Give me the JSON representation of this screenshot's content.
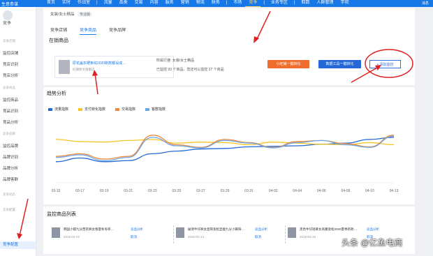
{
  "topbar": {
    "brand": "生意参谋",
    "nav": [
      "首页",
      "实时",
      "作战室",
      "|",
      "流量",
      "品类",
      "交易",
      "内容",
      "服务",
      "营销",
      "物流",
      "财务",
      "|",
      "市场",
      "竞争",
      "|",
      "业务专区",
      "|",
      "取数",
      "人群管理",
      "学院"
    ],
    "active": "竞争",
    "user": "消息"
  },
  "sidebar": {
    "avatar_name": "竞争",
    "items": [
      {
        "type": "group",
        "label": "竞争店铺"
      },
      {
        "type": "item",
        "label": "监控店铺"
      },
      {
        "type": "item",
        "label": "竞店识别"
      },
      {
        "type": "item",
        "label": "竞店分析"
      },
      {
        "type": "group",
        "label": "竞争商品"
      },
      {
        "type": "item",
        "label": "监控商品"
      },
      {
        "type": "item",
        "label": "竞品识别"
      },
      {
        "type": "item",
        "label": "竞品分析"
      },
      {
        "type": "group",
        "label": "竞争品牌"
      },
      {
        "type": "item",
        "label": "监控品牌"
      },
      {
        "type": "item",
        "label": "品牌识别"
      },
      {
        "type": "item",
        "label": "品牌分析"
      },
      {
        "type": "item",
        "label": "品牌客群"
      },
      {
        "type": "group",
        "label": "竞争动态"
      },
      {
        "type": "group",
        "label": "竞争配置"
      },
      {
        "type": "active",
        "label": "竞争配置"
      }
    ]
  },
  "category": {
    "value": "女装/女士精品",
    "switch": "专业版"
  },
  "tabs": [
    "竞争店铺",
    "竞争商品",
    "竞争品牌"
  ],
  "active_tab": "竞争商品",
  "product_section": {
    "title": "在销商品",
    "product_title": "原花盖衣裙条纹2020新款都设成…",
    "shop": "好潮原文旗舰店",
    "category_line": "所属行业: 女装/女士精品",
    "quota_line": "已监控 93 个商品，您还可以监控 27 个商品",
    "btn_orange": "小旺铺一键转化",
    "btn_blue": "数据工具一键转化",
    "btn_add": "+ 添加监控"
  },
  "trend": {
    "title": "趋势分析",
    "colors": {
      "blue": "#2468d8",
      "yellow": "#f3c623",
      "orange": "#f0883a",
      "lightblue": "#6aa7e8"
    }
  },
  "chart_data": {
    "type": "line",
    "title": "趋势分析",
    "xlabel": "",
    "ylabel": "",
    "x": [
      "03-15",
      "03-17",
      "03-19",
      "03-21",
      "03-23",
      "03-25",
      "03-27",
      "03-29",
      "03-31",
      "04-02",
      "04-04",
      "04-06",
      "04-08",
      "04-10",
      "04-13"
    ],
    "legend_position": "top-left",
    "grid": false,
    "series": [
      {
        "name": "流量指数",
        "color": "#2468d8",
        "values": [
          20,
          27,
          20,
          22,
          35,
          40,
          44,
          45,
          48,
          49,
          50,
          53,
          55,
          62,
          66
        ]
      },
      {
        "name": "支付转化指数",
        "color": "#f3c623",
        "values": [
          62,
          58,
          57,
          60,
          62,
          55,
          57,
          56,
          52,
          57,
          55,
          53,
          52,
          56,
          52
        ]
      },
      {
        "name": "交易指数",
        "color": "#f0883a",
        "values": [
          30,
          35,
          25,
          30,
          70,
          52,
          47,
          62,
          56,
          47,
          58,
          60,
          54,
          48,
          70
        ]
      },
      {
        "name": "客群指数",
        "color": "#6aa7e8",
        "values": [
          28,
          33,
          22,
          28,
          66,
          50,
          46,
          60,
          55,
          46,
          56,
          60,
          52,
          47,
          68
        ]
      }
    ]
  },
  "monitor": {
    "title": "监控商品列表",
    "items": [
      {
        "title": "韩国小都九分西装裤女春夏秋冬哆…",
        "date": "2019-04-02",
        "link1": "竞品分析",
        "link2": "取消"
      },
      {
        "title": "破洞牛仔裤女直筒宽松显瘦九分小脚阳…",
        "date": "2020-02-13",
        "link1": "竞品分析",
        "link2": "取消"
      },
      {
        "title": "黑色牛仔短裤女高腰宽松2020夏季新款…",
        "date": "2019-03-15",
        "link1": "竞品分析",
        "link2": "取消"
      }
    ]
  },
  "watermark": "头条 @亿鱼电商"
}
